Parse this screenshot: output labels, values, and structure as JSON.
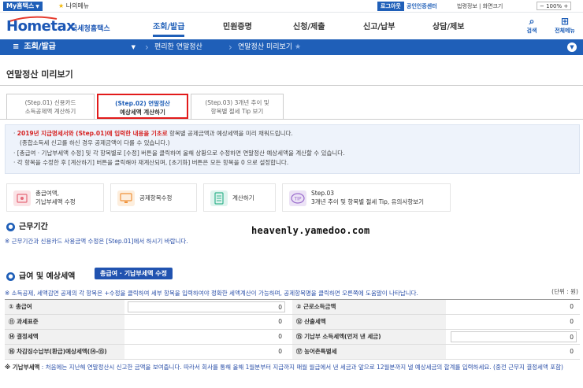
{
  "topbar": {
    "my_hometax": "My홈택스",
    "my_menu": "나의메뉴",
    "logout": "로그아웃",
    "cert_center": "공인인증센터",
    "login_info": "법령정보 | 화면크기",
    "zoom": "100%"
  },
  "header": {
    "logo_text": "Hometax",
    "logo_sub": "국세청홈택스",
    "nav": [
      "조회/발급",
      "민원증명",
      "신청/제출",
      "신고/납부",
      "상담/제보"
    ],
    "search_label": "검색",
    "all_menu_label": "전체메뉴"
  },
  "subnav": {
    "menu_label": "조회/발급",
    "crumbs": [
      "편리한 연말정산",
      "연말정산 미리보기"
    ]
  },
  "page": {
    "title": "연말정산 미리보기"
  },
  "tabs": [
    {
      "line1": "(Step.01) 신용카드",
      "line2": "소득공제액 계산하기"
    },
    {
      "line1": "(Step.02) 연말정산",
      "line2": "예상세액 계산하기"
    },
    {
      "line1": "(Step.03) 3개년 추이 및",
      "line2": "항목별 절세 Tip 보기"
    }
  ],
  "notice": {
    "l1_red": "2019년 지급명세서와 (Step.01)에 입력한 내용을 기초로",
    "l1_rest": " 항목별 공제금액과 예상세액을 미리 채워드립니다.",
    "l2": "(종합소득세 신고를 하신 경우 공제금액이 다를 수 있습니다.)",
    "l3": "[총급여 · 기납부세액 수정] 및 각 항목별로 [수정] 버튼을 클릭하여 올해 상황으로 수정하면 연말정산 예상세액을 계산할 수 있습니다.",
    "l4": "각 항목을 수정한 후 [계산하기] 버튼을 클릭해야 재계산되며, [초기화] 버튼은 모든 항목을 0 으로 설정합니다."
  },
  "steps": [
    {
      "line1": "총급여액,",
      "line2": "기납부세액 수정"
    },
    {
      "line1": "공제항목수정",
      "line2": ""
    },
    {
      "line1": "계산하기",
      "line2": ""
    },
    {
      "line1": "Step.03",
      "line2": "3개년 추이 및 항목별 절세 Tip, 유의사항보기"
    }
  ],
  "sections": {
    "work_period": "근무기간",
    "work_period_note": "※ 근무기간과 신용카드 사용금액 수정은 [Step.01]에서 하시기 바랍니다.",
    "salary": "급여 및 예상세액",
    "salary_button": "총급여 · 기납부세액 수정",
    "salary_note": "※ 소득공제, 세액감면 공제의 각 항목은 +수정을 클릭하여 세부 항목을 입력하여야 정확한 세액계산이 가능하며, 공제항목명을 클릭하면 오른쪽에 도움말이 나타납니다.",
    "unit": "(단위 : 원)"
  },
  "watermark": "heavenly.yamedoo.com",
  "table": [
    {
      "left_label": "① 총급여",
      "left_value": "0",
      "right_label": "② 근로소득금액",
      "right_value": "0"
    },
    {
      "left_label": "⑪ 과세표준",
      "left_value": "0",
      "right_label": "⑫ 산출세액",
      "right_value": "0"
    },
    {
      "left_label": "⑭ 결정세액",
      "left_value": "0",
      "right_label": "⑮ 기납부 소득세액(먼저 낸 세금)",
      "right_value": "0"
    },
    {
      "left_label": "⑯ 차감징수납부(환급)예상세액(⑭-⑮)",
      "left_value": "0",
      "right_label": "⑰ 농어촌특별세",
      "right_value": "0"
    }
  ],
  "footnote": {
    "bold": "※ 기납부세액",
    "rest": " : 처음에는 지난해 연말정산시 신고한 금액을 보여줍니다. 따라서 회사를 통해 올해 1월분부터 지급까지 매월 월급에서 낸 세금과 앞으로 12월분까지 낼 예상세금의 합계를 입력하세요. (중전 근무지 결정세액 포함)"
  },
  "colors": {
    "brand": "#1f5fb8",
    "highlight": "#e21b1b"
  }
}
